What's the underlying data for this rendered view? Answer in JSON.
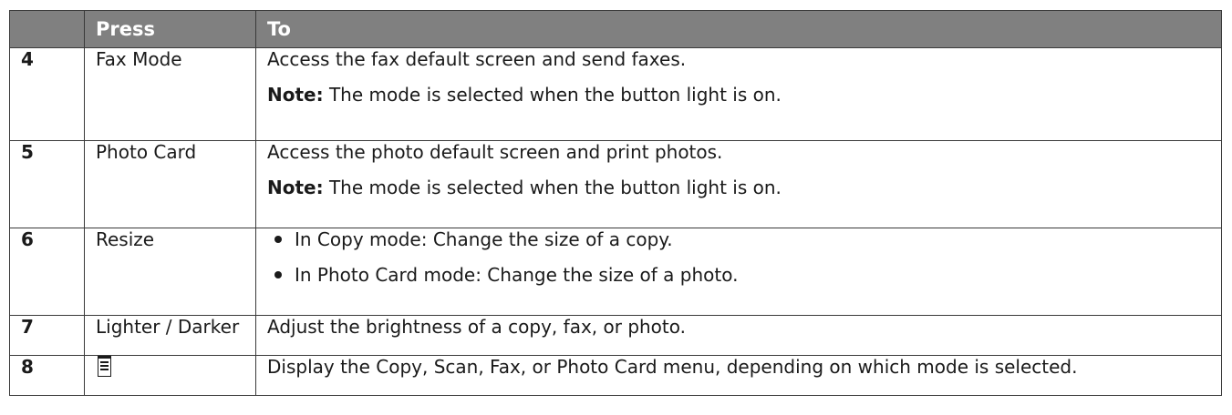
{
  "table": {
    "header": {
      "number": "",
      "press": "Press",
      "to": "To"
    },
    "rows": [
      {
        "number": "4",
        "press": "Fax Mode",
        "to": "Access the fax default screen and send faxes.",
        "note_label": "Note:",
        "note_text": " The mode is selected when the button light is on."
      },
      {
        "number": "5",
        "press": "Photo Card",
        "to": "Access the photo default screen and print photos.",
        "note_label": "Note:",
        "note_text": " The mode is selected when the button light is on."
      },
      {
        "number": "6",
        "press": "Resize",
        "bullets": [
          "In Copy mode: Change the size of a copy.",
          "In Photo Card mode: Change the size of a photo."
        ]
      },
      {
        "number": "7",
        "press": "Lighter / Darker",
        "to": "Adjust the brightness of a copy, fax, or photo."
      },
      {
        "number": "8",
        "press_icon": "menu-icon",
        "to": "Display the Copy, Scan, Fax, or Photo Card menu, depending on which mode is selected."
      }
    ]
  },
  "colors": {
    "header_background": "#808080",
    "header_text": "#ffffff",
    "border": "#3a3a3a",
    "text": "#1a1a1a"
  }
}
